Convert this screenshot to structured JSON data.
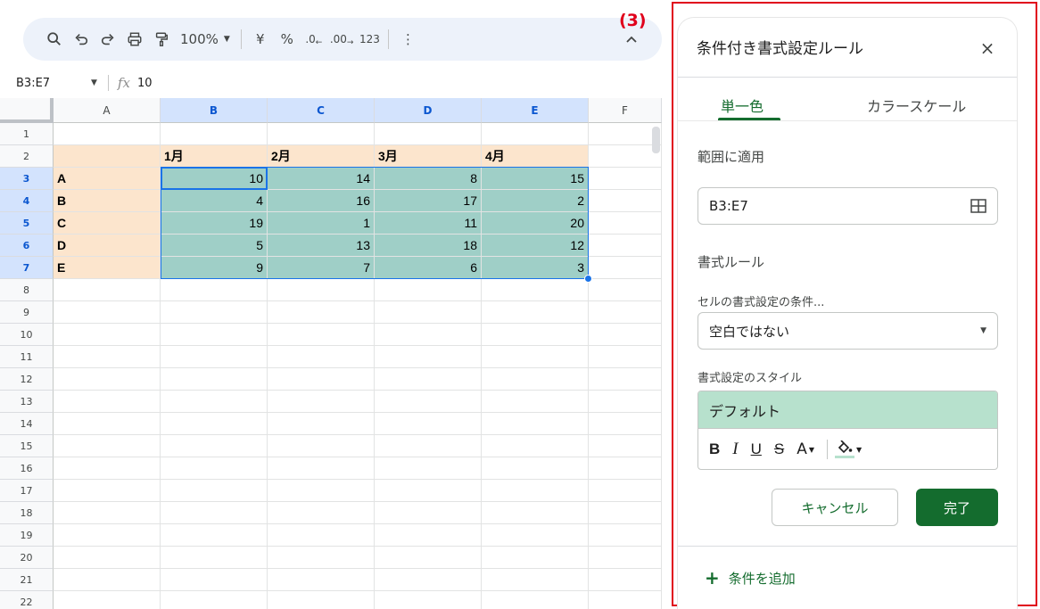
{
  "colors": {
    "header_fill": "#fce5cd",
    "data_fill": "#9fcfc7",
    "accent_green": "#146c2e",
    "selection_blue": "#1a73e8",
    "annotation_red": "#e0001b",
    "style_preview": "#b7e1cd"
  },
  "annotation": {
    "label": "(3)"
  },
  "toolbar": {
    "zoom": "100%",
    "currency": "¥",
    "percent": "%",
    "decrease_decimals": ".0",
    "increase_decimals": ".00",
    "number_format": "123",
    "more": "⋮"
  },
  "formula_bar": {
    "name_box": "B3:E7",
    "fx": "fx",
    "value": "10"
  },
  "sheet": {
    "columns": [
      "A",
      "B",
      "C",
      "D",
      "E",
      "F"
    ],
    "rows": [
      "1",
      "2",
      "3",
      "4",
      "5",
      "6",
      "7",
      "8",
      "9",
      "10",
      "11",
      "12",
      "13",
      "14",
      "15",
      "16",
      "17",
      "18",
      "19",
      "20",
      "21",
      "22"
    ],
    "header_row": [
      "",
      "1月",
      "2月",
      "3月",
      "4月"
    ],
    "data": [
      {
        "label": "A",
        "values": [
          "10",
          "14",
          "8",
          "15"
        ]
      },
      {
        "label": "B",
        "values": [
          "4",
          "16",
          "17",
          "2"
        ]
      },
      {
        "label": "C",
        "values": [
          "19",
          "1",
          "11",
          "20"
        ]
      },
      {
        "label": "D",
        "values": [
          "5",
          "13",
          "18",
          "12"
        ]
      },
      {
        "label": "E",
        "values": [
          "9",
          "7",
          "6",
          "3"
        ]
      }
    ]
  },
  "panel": {
    "title": "条件付き書式設定ルール",
    "close": "×",
    "tabs": [
      "単一色",
      "カラースケール"
    ],
    "range_label": "範囲に適用",
    "range_value": "B3:E7",
    "rules_label": "書式ルール",
    "condition_label": "セルの書式設定の条件...",
    "condition_value": "空白ではない",
    "style_label": "書式設定のスタイル",
    "style_preview": "デフォルト",
    "style_tools": {
      "bold": "B",
      "italic": "I",
      "underline": "U",
      "strike": "S",
      "text_color": "A"
    },
    "cancel": "キャンセル",
    "done": "完了",
    "add_rule": "条件を追加",
    "add_plus": "+"
  }
}
